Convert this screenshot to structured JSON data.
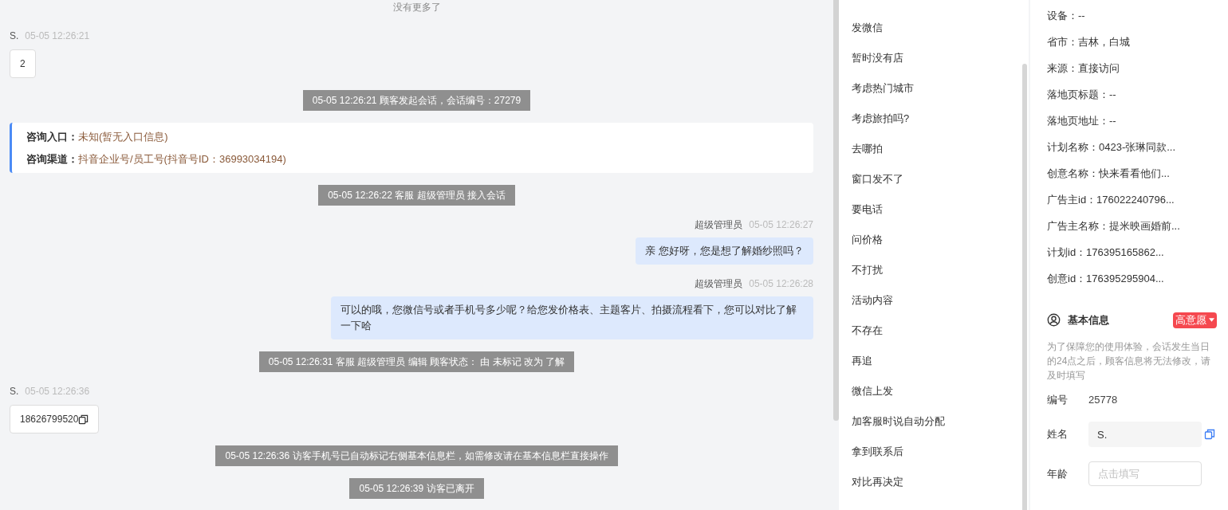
{
  "chat": {
    "no_more": "没有更多了",
    "messages": [
      {
        "kind": "visitor",
        "sender": "S.",
        "time": "05-05 12:26:21",
        "text": "2",
        "copy": false
      },
      {
        "kind": "system",
        "text": "05-05 12:26:21 顾客发起会话，会话编号：27279"
      },
      {
        "kind": "source",
        "lines": [
          {
            "label": "咨询入口：",
            "value": "未知(暂无入口信息)"
          },
          {
            "label": "咨询渠道：",
            "value": "抖音企业号/员工号(抖音号ID：36993034194)"
          }
        ]
      },
      {
        "kind": "system",
        "text": "05-05 12:26:22 客服 超级管理员 接入会话"
      },
      {
        "kind": "agent",
        "sender": "超级管理员",
        "time": "05-05 12:26:27",
        "text": "亲 您好呀，您是想了解婚纱照吗？"
      },
      {
        "kind": "agent",
        "sender": "超级管理员",
        "time": "05-05 12:26:28",
        "text": "可以的哦，您微信号或者手机号多少呢？给您发价格表、主题客片、拍摄流程看下，您可以对比了解一下哈"
      },
      {
        "kind": "system",
        "text": "05-05 12:26:31 客服 超级管理员 编辑 顾客状态： 由 未标记 改为 了解"
      },
      {
        "kind": "visitor",
        "sender": "S.",
        "time": "05-05 12:26:36",
        "text": "18626799520",
        "copy": true
      },
      {
        "kind": "system",
        "text": "05-05 12:26:36 访客手机号已自动标记右侧基本信息栏，如需修改请在基本信息栏直接操作"
      },
      {
        "kind": "system",
        "text": "05-05 12:26:39 访客已离开"
      }
    ]
  },
  "quick_replies": [
    "发微信",
    "暂时没有店",
    "考虑热门城市",
    "考虑旅拍吗?",
    "去哪拍",
    "窗口发不了",
    "要电话",
    "问价格",
    "不打扰",
    "活动内容",
    "不存在",
    "再追",
    "微信上发",
    "加客服时说自动分配",
    "拿到联系后",
    "对比再决定"
  ],
  "visitor_info": [
    "设备：--",
    "省市：吉林，白城",
    "来源：直接访问",
    "落地页标题：--",
    "落地页地址：--",
    "计划名称：0423-张琳同款...",
    "创意名称：快来看看他们...",
    "广告主id：176022240796...",
    "广告主名称：提米映画婚前...",
    "计划id：176395165862...",
    "创意id：176395295904..."
  ],
  "basic_info": {
    "title": "基本信息",
    "intent_tag": "高意愿",
    "notice": "为了保障您的使用体验，会话发生当日的24点之后，顾客信息将无法修改，请及时填写",
    "fields": [
      {
        "kind": "text",
        "label": "编号",
        "value": "25778"
      },
      {
        "kind": "input",
        "label": "姓名",
        "value": "S.",
        "copy": true
      },
      {
        "kind": "input",
        "label": "年龄",
        "placeholder": "点击填写"
      }
    ]
  }
}
